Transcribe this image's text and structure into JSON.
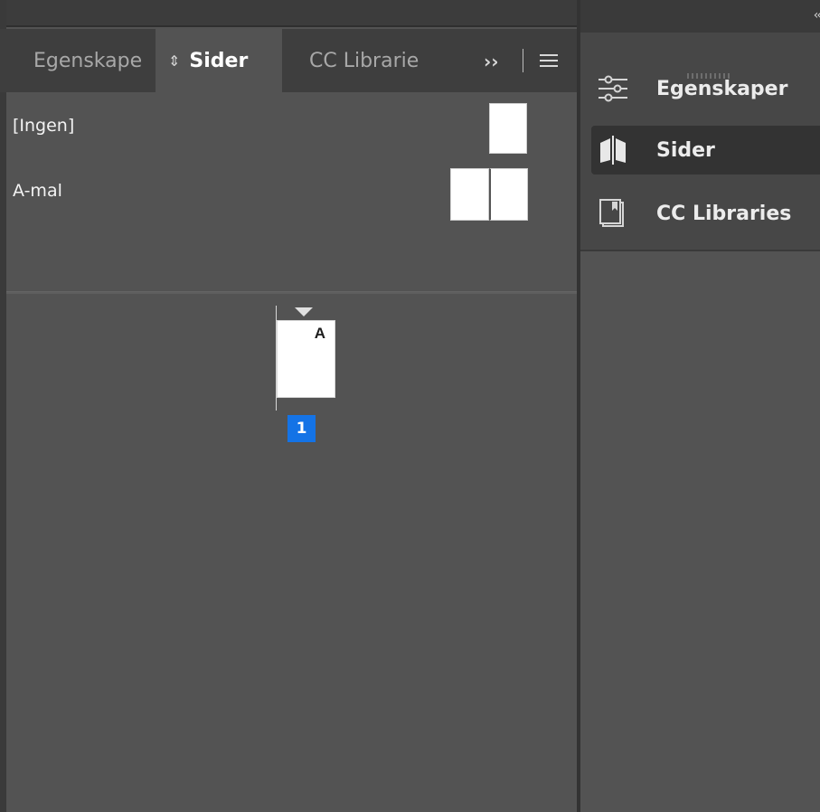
{
  "pages_panel": {
    "tabs": {
      "egenskaper": "Egenskape",
      "sider": "Sider",
      "cc_libraries": "CC Librarie"
    },
    "overflow_chevron": "››",
    "masters": [
      {
        "label": "[Ingen]"
      },
      {
        "label": "A-mal"
      }
    ],
    "document_page": {
      "master_letter": "A",
      "page_number": "1"
    }
  },
  "dock": {
    "collapse_arrows": "‹‹",
    "items": {
      "egenskaper": "Egenskaper",
      "sider": "Sider",
      "cc_libraries": "CC Libraries"
    }
  },
  "colors": {
    "panel_bg": "#535353",
    "selection_blue": "#1473e6"
  }
}
